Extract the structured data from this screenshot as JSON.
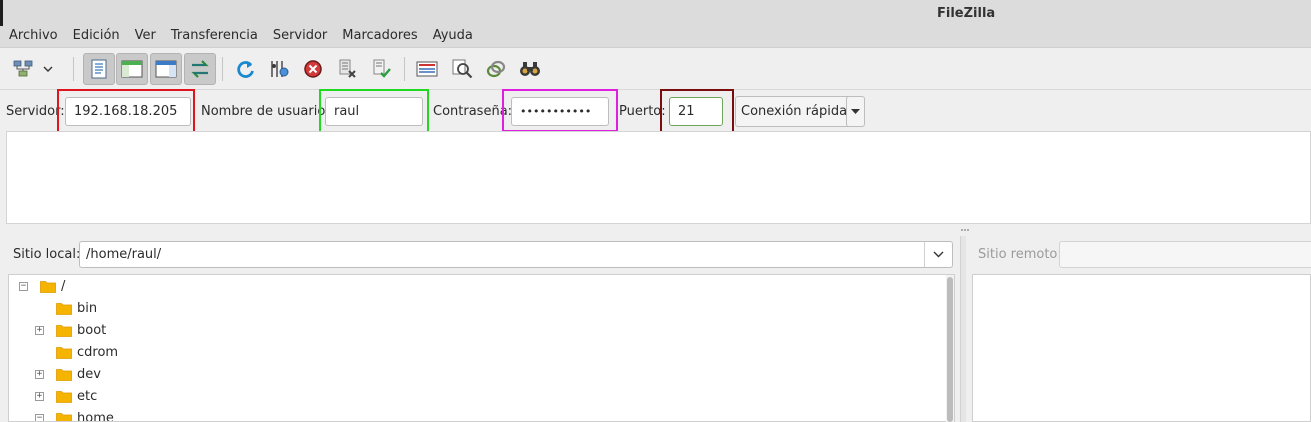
{
  "window": {
    "title": "FileZilla"
  },
  "menu": [
    "Archivo",
    "Edición",
    "Ver",
    "Transferencia",
    "Servidor",
    "Marcadores",
    "Ayuda"
  ],
  "toolbar": {
    "icons": [
      "site-manager-icon",
      "site-manager-dropdown-icon",
      "toggle-message-log-icon",
      "toggle-local-tree-icon",
      "toggle-remote-tree-icon",
      "toggle-queue-icon",
      "refresh-icon",
      "process-queue-icon",
      "cancel-icon",
      "disconnect-icon",
      "reconnect-icon",
      "directory-comparison-icon",
      "filter-icon",
      "sync-browsing-icon",
      "search-binoculars-icon"
    ]
  },
  "quickconnect": {
    "host_label": "Servidor:",
    "host_value": "192.168.18.205",
    "user_label": "Nombre de usuario:",
    "user_value": "raul",
    "pass_label": "Contraseña:",
    "pass_value": "•••••••••••",
    "port_label": "Puerto:",
    "port_value": "21",
    "connect_label": "Conexión rápida"
  },
  "highlights": {
    "host": "#e0141e",
    "user": "#22d922",
    "pass": "#e020e0",
    "port": "#7a0e0e"
  },
  "local": {
    "label": "Sitio local:",
    "path": "/home/raul/",
    "tree": [
      {
        "name": "/",
        "expander": "−",
        "level": 0
      },
      {
        "name": "bin",
        "expander": "",
        "level": 1
      },
      {
        "name": "boot",
        "expander": "+",
        "level": 1
      },
      {
        "name": "cdrom",
        "expander": "",
        "level": 1
      },
      {
        "name": "dev",
        "expander": "+",
        "level": 1
      },
      {
        "name": "etc",
        "expander": "+",
        "level": 1
      },
      {
        "name": "home",
        "expander": "−",
        "level": 1
      }
    ]
  },
  "remote": {
    "label": "Sitio remoto:"
  },
  "colors": {
    "folder": "#f5b400",
    "folder_dark": "#e09a00"
  }
}
